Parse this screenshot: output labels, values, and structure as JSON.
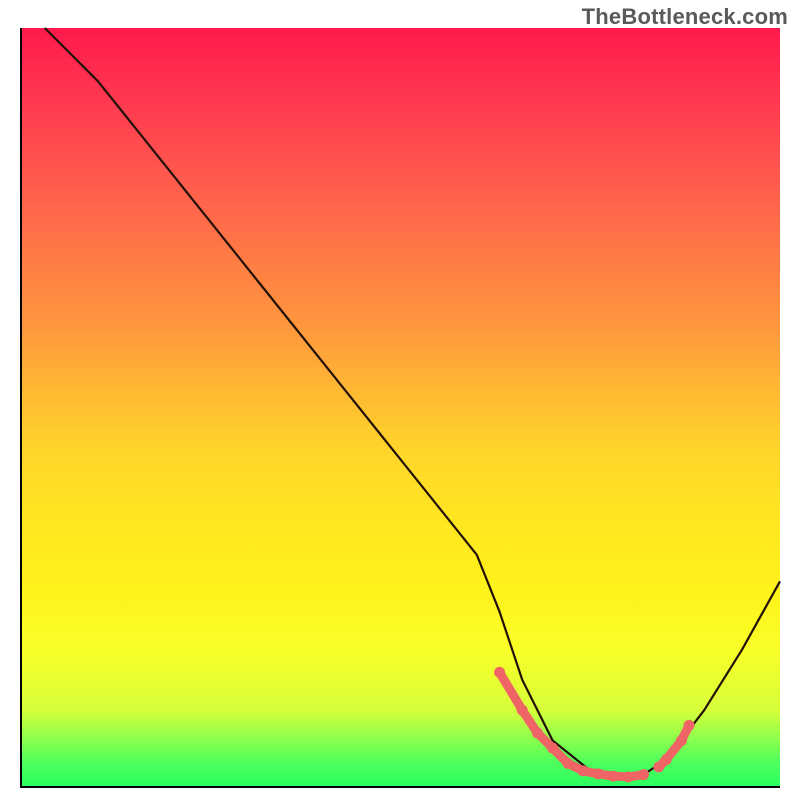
{
  "watermark": {
    "text": "TheBottleneck.com"
  },
  "chart_data": {
    "type": "line",
    "title": "",
    "xlabel": "",
    "ylabel": "",
    "xlim": [
      0,
      100
    ],
    "ylim": [
      0,
      100
    ],
    "grid": false,
    "series": [
      {
        "name": "curve",
        "x": [
          3,
          10,
          20,
          30,
          40,
          50,
          60,
          63,
          66,
          70,
          75,
          80,
          82,
          85,
          90,
          95,
          100
        ],
        "y": [
          100,
          93,
          80.5,
          68,
          55.5,
          43,
          30.5,
          23,
          14,
          6,
          2,
          1.2,
          1.5,
          3.5,
          10,
          18,
          27
        ],
        "stroke": "#231108"
      }
    ],
    "highlight_cluster": {
      "name": "bottom-dots",
      "color": "#ef6464",
      "x": [
        63,
        66,
        68,
        70,
        72,
        74,
        76,
        78,
        80,
        82,
        84,
        85,
        87,
        88
      ],
      "y": [
        15,
        10,
        7,
        5,
        3,
        2,
        1.6,
        1.3,
        1.2,
        1.5,
        2.5,
        3.5,
        6,
        8
      ]
    },
    "colors": {
      "gradient_top": "#ff1a4d",
      "gradient_mid": "#ffe820",
      "gradient_bottom": "#2bff60",
      "curve": "#231108",
      "cluster": "#ef6464",
      "axes": "#000000"
    }
  }
}
